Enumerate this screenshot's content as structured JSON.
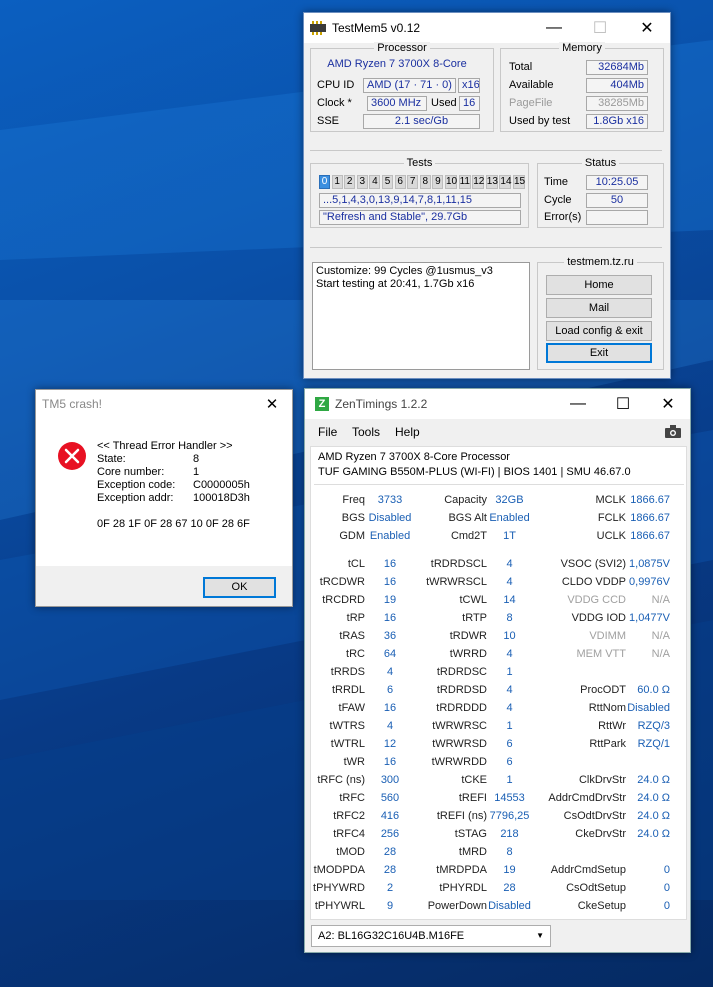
{
  "testmem": {
    "title": "TestMem5 v0.12",
    "processor": {
      "group": "Processor",
      "name": "AMD Ryzen 7 3700X 8-Core",
      "cpuid_label": "CPU ID",
      "cpuid": "AMD  (17 · 71 · 0)",
      "cpuid_threads": "x16",
      "clock_label": "Clock *",
      "clock": "3600 MHz",
      "used_label": "Used",
      "used": "16",
      "sse_label": "SSE",
      "sse": "2.1 sec/Gb"
    },
    "memory": {
      "group": "Memory",
      "total_label": "Total",
      "total": "32684Mb",
      "available_label": "Available",
      "available": "404Mb",
      "pagefile_label": "PageFile",
      "pagefile": "38285Mb",
      "usedby_label": "Used by test",
      "usedby": "1.8Gb x16"
    },
    "tests": {
      "group": "Tests",
      "numbers": [
        "0",
        "1",
        "2",
        "3",
        "4",
        "5",
        "6",
        "7",
        "8",
        "9",
        "10",
        "11",
        "12",
        "13",
        "14",
        "15"
      ],
      "sequence": "...5,1,4,3,0,13,9,14,7,8,1,11,15",
      "config": "\"Refresh and Stable\", 29.7Gb"
    },
    "status": {
      "group": "Status",
      "time_label": "Time",
      "time": "10:25.05",
      "cycle_label": "Cycle",
      "cycle": "50",
      "errors_label": "Error(s)",
      "errors": ""
    },
    "log": {
      "line1": "Customize: 99 Cycles @1usmus_v3",
      "line2": "Start testing at 20:41, 1.7Gb x16"
    },
    "links": {
      "group": "testmem.tz.ru",
      "home": "Home",
      "mail": "Mail",
      "load": "Load config & exit",
      "exit": "Exit"
    }
  },
  "crash": {
    "title": "TM5 crash!",
    "header": "<< Thread Error Handler  >>",
    "state_label": "State:",
    "state": "8",
    "core_label": "Core number:",
    "core": "1",
    "code_label": "Exception code:",
    "code": "C0000005h",
    "addr_label": "Exception addr:",
    "addr": "100018D3h",
    "bytes": "0F 28 1F 0F 28 67 10 0F 28 6F",
    "ok": "OK"
  },
  "zen": {
    "title": "ZenTimings 1.2.2",
    "menu": [
      "File",
      "Tools",
      "Help"
    ],
    "cpu": "AMD Ryzen 7 3700X 8-Core Processor",
    "board": "TUF GAMING B550M-PLUS (WI-FI) | BIOS 1401 | SMU 46.67.0",
    "rows1": [
      [
        "Freq",
        "3733",
        "Capacity",
        "32GB",
        "MCLK",
        "1866.67"
      ],
      [
        "BGS",
        "Disabled",
        "BGS Alt",
        "Enabled",
        "FCLK",
        "1866.67"
      ],
      [
        "GDM",
        "Enabled",
        "Cmd2T",
        "1T",
        "UCLK",
        "1866.67"
      ]
    ],
    "rows2": [
      [
        "tCL",
        "16",
        "tRDRDSCL",
        "4",
        "VSOC (SVI2)",
        "1,0875V"
      ],
      [
        "tRCDWR",
        "16",
        "tWRWRSCL",
        "4",
        "CLDO VDDP",
        "0,9976V"
      ],
      [
        "tRCDRD",
        "19",
        "tCWL",
        "14",
        "VDDG CCD",
        "N/A"
      ],
      [
        "tRP",
        "16",
        "tRTP",
        "8",
        "VDDG IOD",
        "1,0477V"
      ],
      [
        "tRAS",
        "36",
        "tRDWR",
        "10",
        "VDIMM",
        "N/A"
      ],
      [
        "tRC",
        "64",
        "tWRRD",
        "4",
        "MEM VTT",
        "N/A"
      ],
      [
        "tRRDS",
        "4",
        "tRDRDSC",
        "1",
        "",
        ""
      ],
      [
        "tRRDL",
        "6",
        "tRDRDSD",
        "4",
        "ProcODT",
        "60.0 Ω"
      ],
      [
        "tFAW",
        "16",
        "tRDRDDD",
        "4",
        "RttNom",
        "Disabled"
      ],
      [
        "tWTRS",
        "4",
        "tWRWRSC",
        "1",
        "RttWr",
        "RZQ/3"
      ],
      [
        "tWTRL",
        "12",
        "tWRWRSD",
        "6",
        "RttPark",
        "RZQ/1"
      ],
      [
        "tWR",
        "16",
        "tWRWRDD",
        "6",
        "",
        ""
      ],
      [
        "tRFC (ns)",
        "300",
        "tCKE",
        "1",
        "ClkDrvStr",
        "24.0 Ω"
      ],
      [
        "tRFC",
        "560",
        "tREFI",
        "14553",
        "AddrCmdDrvStr",
        "24.0 Ω"
      ],
      [
        "tRFC2",
        "416",
        "tREFI (ns)",
        "7796,25",
        "CsOdtDrvStr",
        "24.0 Ω"
      ],
      [
        "tRFC4",
        "256",
        "tSTAG",
        "218",
        "CkeDrvStr",
        "24.0 Ω"
      ],
      [
        "tMOD",
        "28",
        "tMRD",
        "8",
        "",
        ""
      ],
      [
        "tMODPDA",
        "28",
        "tMRDPDA",
        "19",
        "AddrCmdSetup",
        "0"
      ],
      [
        "tPHYWRD",
        "2",
        "tPHYRDL",
        "28",
        "CsOdtSetup",
        "0"
      ],
      [
        "tPHYWRL",
        "9",
        "PowerDown",
        "Disabled",
        "CkeSetup",
        "0"
      ]
    ],
    "module": "A2: BL16G32C16U4B.M16FE"
  }
}
